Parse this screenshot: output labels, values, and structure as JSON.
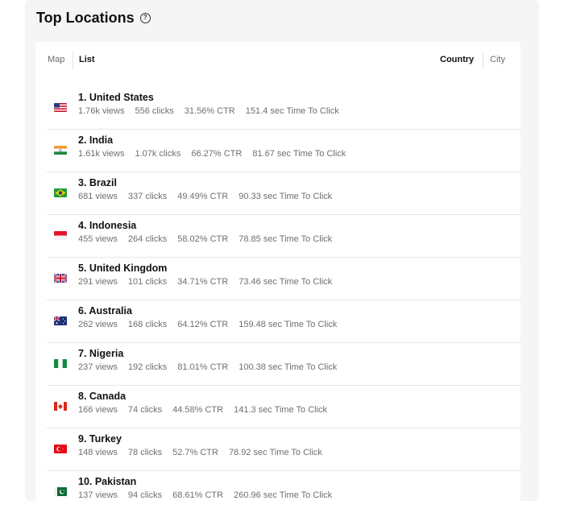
{
  "header": {
    "title": "Top Locations",
    "help_icon": "question-circle-icon"
  },
  "view_tabs": {
    "map": "Map",
    "list": "List",
    "active": "List"
  },
  "group_tabs": {
    "country": "Country",
    "city": "City",
    "active": "Country"
  },
  "locations": [
    {
      "rank_name": "1. United States",
      "views": "1.76k views",
      "clicks": "556 clicks",
      "ctr": "31.56% CTR",
      "time": "151.4 sec Time To Click",
      "flag": "us-flag-icon"
    },
    {
      "rank_name": "2. India",
      "views": "1.61k views",
      "clicks": "1.07k clicks",
      "ctr": "66.27% CTR",
      "time": "81.67 sec Time To Click",
      "flag": "in-flag-icon"
    },
    {
      "rank_name": "3. Brazil",
      "views": "681 views",
      "clicks": "337 clicks",
      "ctr": "49.49% CTR",
      "time": "90.33 sec Time To Click",
      "flag": "br-flag-icon"
    },
    {
      "rank_name": "4. Indonesia",
      "views": "455 views",
      "clicks": "264 clicks",
      "ctr": "58.02% CTR",
      "time": "78.85 sec Time To Click",
      "flag": "id-flag-icon"
    },
    {
      "rank_name": "5. United Kingdom",
      "views": "291 views",
      "clicks": "101 clicks",
      "ctr": "34.71% CTR",
      "time": "73.46 sec Time To Click",
      "flag": "gb-flag-icon"
    },
    {
      "rank_name": "6. Australia",
      "views": "262 views",
      "clicks": "168 clicks",
      "ctr": "64.12% CTR",
      "time": "159.48 sec Time To Click",
      "flag": "au-flag-icon"
    },
    {
      "rank_name": "7. Nigeria",
      "views": "237 views",
      "clicks": "192 clicks",
      "ctr": "81.01% CTR",
      "time": "100.38 sec Time To Click",
      "flag": "ng-flag-icon"
    },
    {
      "rank_name": "8. Canada",
      "views": "166 views",
      "clicks": "74 clicks",
      "ctr": "44.58% CTR",
      "time": "141.3 sec Time To Click",
      "flag": "ca-flag-icon"
    },
    {
      "rank_name": "9. Turkey",
      "views": "148 views",
      "clicks": "78 clicks",
      "ctr": "52.7% CTR",
      "time": "78.92 sec Time To Click",
      "flag": "tr-flag-icon"
    },
    {
      "rank_name": "10. Pakistan",
      "views": "137 views",
      "clicks": "94 clicks",
      "ctr": "68.61% CTR",
      "time": "260.96 sec Time To Click",
      "flag": "pk-flag-icon"
    }
  ]
}
